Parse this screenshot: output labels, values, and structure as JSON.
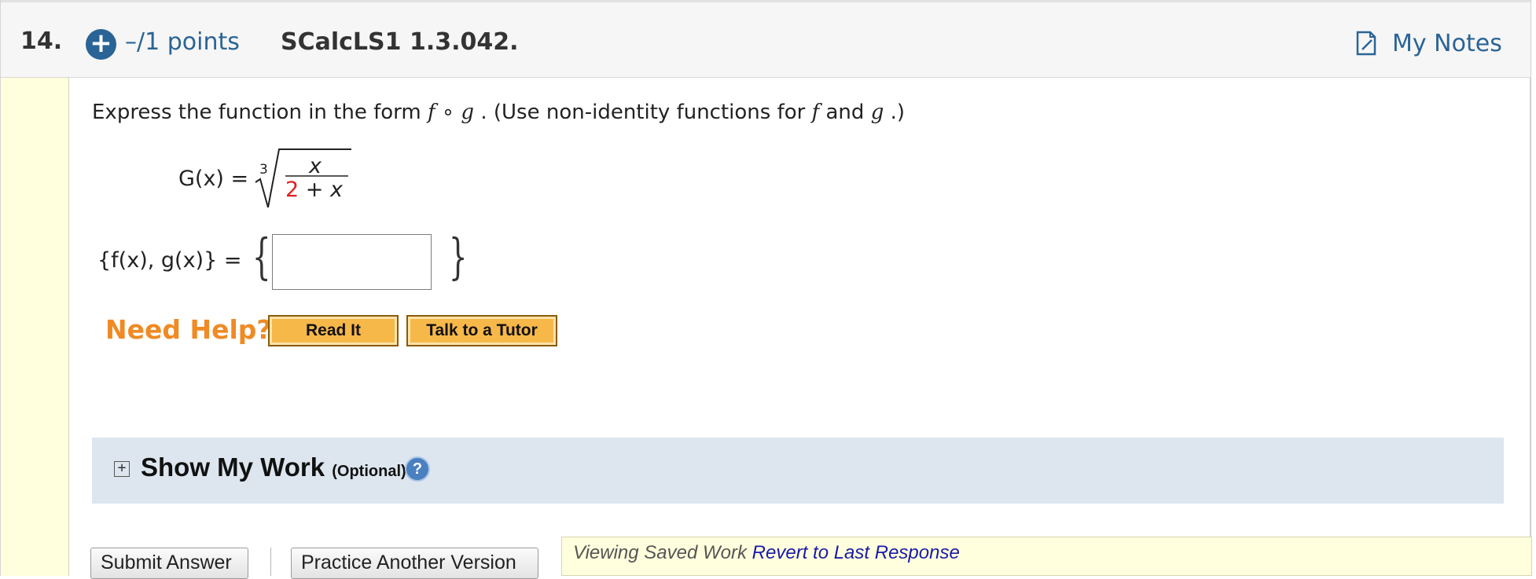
{
  "header": {
    "question_number": "14.",
    "add_icon": "plus-circle-icon",
    "points": "–/1 points",
    "question_code": "SCalcLS1 1.3.042.",
    "my_notes_label": "My Notes",
    "notes_icon": "notes-icon"
  },
  "problem": {
    "prompt_part1": "Express the function in the form ",
    "prompt_f": "f",
    "prompt_circ": " ∘ ",
    "prompt_g": "g",
    "prompt_part2": ".  (Use non-identity functions for ",
    "prompt_f2": "f",
    "prompt_and": " and ",
    "prompt_g2": "g",
    "prompt_end": ".)",
    "G_lhs": "G(x)  =",
    "root_index": "3",
    "numerator": "x",
    "denominator_red": "2",
    "denominator_rest": " + x",
    "fg_label": "{f(x), g(x)}  =",
    "left_brace": "{",
    "right_brace": "}",
    "answer_value": ""
  },
  "help": {
    "need_help_label": "Need Help?",
    "read_it_label": "Read It",
    "tutor_label": "Talk to a Tutor"
  },
  "show_work": {
    "toggle_icon": "expand-plus-icon",
    "title": "Show My Work",
    "optional": "(Optional)",
    "help_icon": "question-mark-icon",
    "help_glyph": "?"
  },
  "footer": {
    "submit_label": "Submit Answer",
    "practice_label": "Practice Another Version",
    "viewing_text": "Viewing Saved Work ",
    "revert_link": "Revert to Last Response"
  },
  "colors": {
    "accent_blue": "#2a6496",
    "need_help_orange": "#f08a24",
    "help_button": "#f7b84a",
    "side_strip": "#ffffdd",
    "show_work_bg": "#dde6ef",
    "red_term": "#e02020"
  }
}
